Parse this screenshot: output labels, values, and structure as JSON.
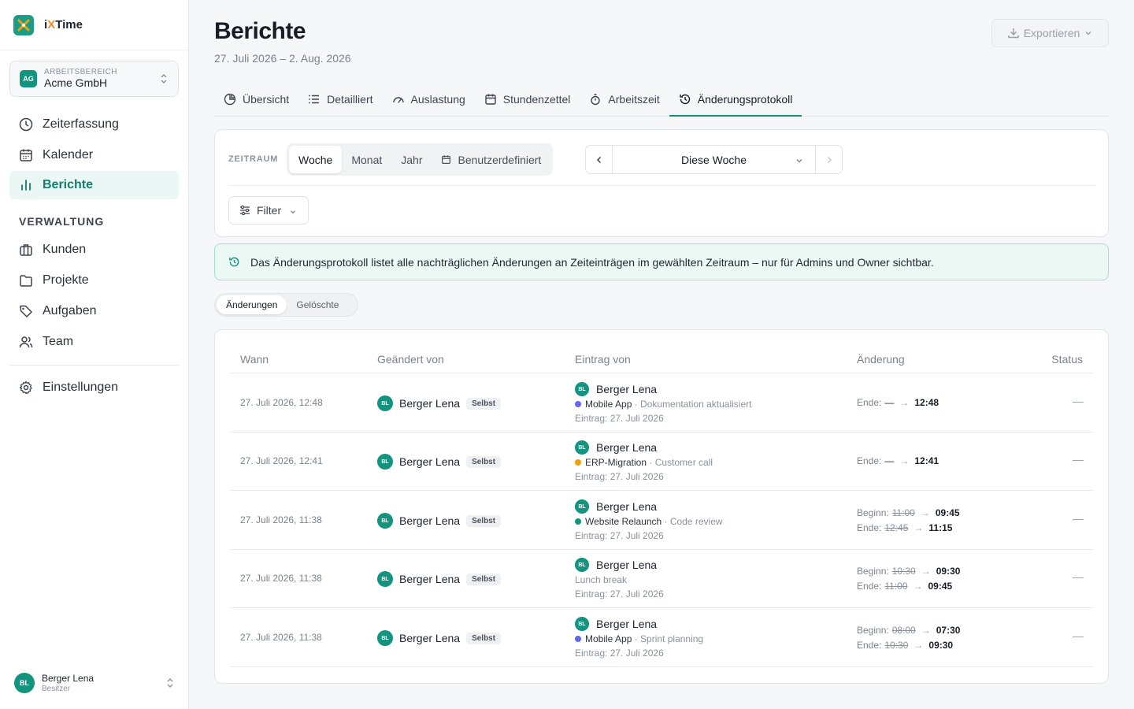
{
  "app": {
    "name_prefix": "i",
    "name_x": "X",
    "name_rest": "Time"
  },
  "workspace": {
    "caption": "ARBEITSBEREICH",
    "name": "Acme GmbH",
    "initials": "AG"
  },
  "nav": {
    "zeiterfassung": "Zeiterfassung",
    "kalender": "Kalender",
    "berichte": "Berichte",
    "section": "VERWALTUNG",
    "kunden": "Kunden",
    "projekte": "Projekte",
    "aufgaben": "Aufgaben",
    "team": "Team",
    "einstellungen": "Einstellungen"
  },
  "user": {
    "name": "Berger Lena",
    "role": "Besitzer",
    "initials": "BL"
  },
  "page": {
    "title": "Berichte",
    "daterange": "27. Juli 2026 – 2. Aug. 2026",
    "export": "Exportieren"
  },
  "tabs": [
    "Übersicht",
    "Detailliert",
    "Auslastung",
    "Stundenzettel",
    "Arbeitszeit",
    "Änderungsprotokoll"
  ],
  "period": {
    "label": "ZEITRAUM",
    "options": [
      "Woche",
      "Monat",
      "Jahr",
      "Benutzerdefiniert"
    ],
    "selected": "Diese Woche",
    "filter": "Filter"
  },
  "info": "Das Änderungsprotokoll listet alle nachträglichen Änderungen an Zeiteinträgen im gewählten Zeitraum – nur für Admins und Owner sichtbar.",
  "subtabs": [
    "Änderungen",
    "Gelöschte"
  ],
  "table": {
    "headers": {
      "when": "Wann",
      "by": "Geändert von",
      "entry": "Eintrag von",
      "change": "Änderung",
      "status": "Status"
    },
    "rows": [
      {
        "when": "27. Juli 2026, 12:48",
        "by": "Berger Lena",
        "badge": "Selbst",
        "entry_user": "Berger Lena",
        "project": "Mobile App",
        "project_color": "#6366f1",
        "desc": "· Dokumentation aktualisiert",
        "date": "Eintrag: 27. Juli 2026",
        "c1_label": "Ende:",
        "c1_old": "—",
        "c1_new": "12:48",
        "status": "—"
      },
      {
        "when": "27. Juli 2026, 12:41",
        "by": "Berger Lena",
        "badge": "Selbst",
        "entry_user": "Berger Lena",
        "project": "ERP-Migration",
        "project_color": "#f59e0b",
        "desc": "· Customer call",
        "date": "Eintrag: 27. Juli 2026",
        "c1_label": "Ende:",
        "c1_old": "—",
        "c1_new": "12:41",
        "status": "—"
      },
      {
        "when": "27. Juli 2026, 11:38",
        "by": "Berger Lena",
        "badge": "Selbst",
        "entry_user": "Berger Lena",
        "project": "Website Relaunch",
        "project_color": "#12947f",
        "desc": "· Code review",
        "date": "Eintrag: 27. Juli 2026",
        "c1_label": "Beginn:",
        "c1_old": "11:00",
        "c1_new": "09:45",
        "c2_label": "Ende:",
        "c2_old": "12:45",
        "c2_new": "11:15",
        "status": "—"
      },
      {
        "when": "27. Juli 2026, 11:38",
        "by": "Berger Lena",
        "badge": "Selbst",
        "entry_user": "Berger Lena",
        "plain_desc": "Lunch break",
        "date": "Eintrag: 27. Juli 2026",
        "c1_label": "Beginn:",
        "c1_old": "10:30",
        "c1_new": "09:30",
        "c2_label": "Ende:",
        "c2_old": "11:00",
        "c2_new": "09:45",
        "status": "—"
      },
      {
        "when": "27. Juli 2026, 11:38",
        "by": "Berger Lena",
        "badge": "Selbst",
        "entry_user": "Berger Lena",
        "project": "Mobile App",
        "project_color": "#6366f1",
        "desc": "· Sprint planning",
        "date": "Eintrag: 27. Juli 2026",
        "c1_label": "Beginn:",
        "c1_old": "08:00",
        "c1_new": "07:30",
        "c2_label": "Ende:",
        "c2_old": "10:30",
        "c2_new": "09:30",
        "status": "—"
      }
    ]
  },
  "colors": {
    "accent": "#12947f",
    "accent_bg": "#eaf7f4",
    "info_bg": "#ecf8f4",
    "info_border": "#a7dfcf"
  }
}
